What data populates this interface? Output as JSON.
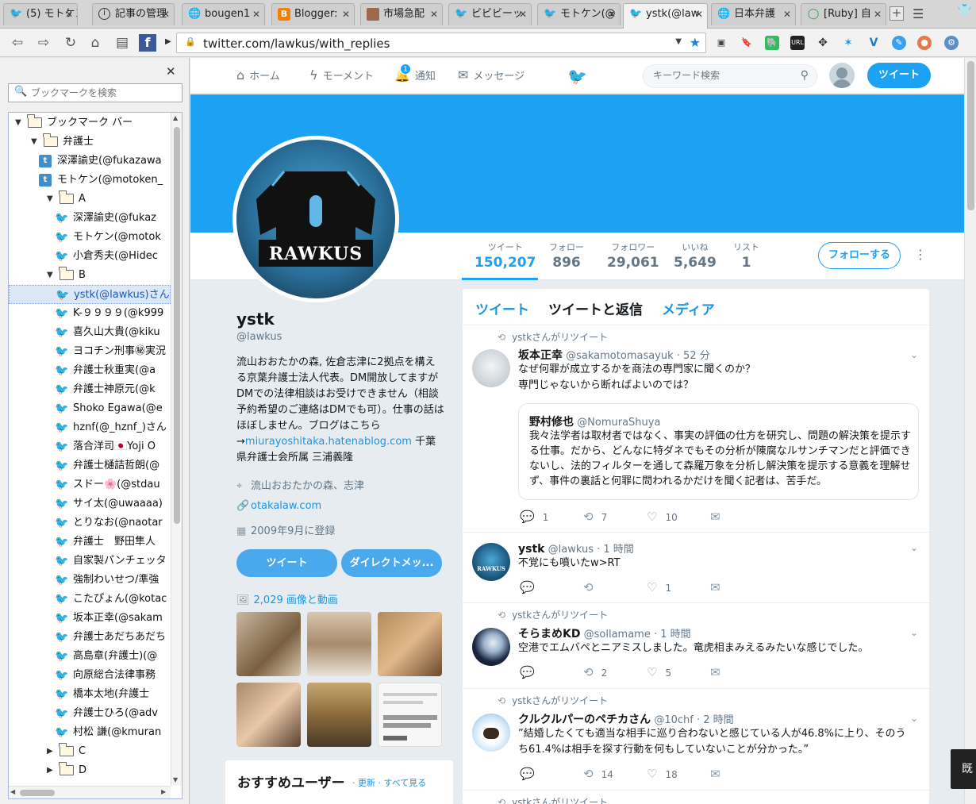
{
  "tabs": [
    {
      "label": "(5) モトケン",
      "icon": "twitter-icon"
    },
    {
      "label": "記事の管理",
      "icon": "info-icon"
    },
    {
      "label": "bougen1",
      "icon": "globe-icon"
    },
    {
      "label": "Blogger:",
      "icon": "blogger-icon"
    },
    {
      "label": "市場急配",
      "icon": "photo-icon"
    },
    {
      "label": "ビビビーッ",
      "icon": "twitter-icon"
    },
    {
      "label": "モトケン(@",
      "icon": "twitter-icon"
    },
    {
      "label": "ystk(@law",
      "icon": "twitter-icon"
    },
    {
      "label": "日本弁護",
      "icon": "globe-icon"
    },
    {
      "label": "[Ruby] 自",
      "icon": "green-icon"
    }
  ],
  "browser": {
    "url": "twitter.com/lawkus/with_replies",
    "ext_labels": [
      "URL"
    ]
  },
  "sidebar": {
    "search_placeholder": "ブックマークを検索",
    "items": [
      {
        "label": "ブックマーク バー",
        "type": "folder",
        "depth": 0,
        "expanded": true
      },
      {
        "label": "弁護士",
        "type": "folder",
        "depth": 1,
        "expanded": true
      },
      {
        "label": "深澤諭史(@fukazawa",
        "type": "bookmark-tb",
        "depth": 2
      },
      {
        "label": "モトケン(@motoken_",
        "type": "bookmark-tb",
        "depth": 2
      },
      {
        "label": "A",
        "type": "folder",
        "depth": 2,
        "expanded": true
      },
      {
        "label": "深澤諭史(@fukaz",
        "type": "bookmark",
        "depth": 3
      },
      {
        "label": "モトケン(@motok",
        "type": "bookmark",
        "depth": 3
      },
      {
        "label": "小倉秀夫(@Hidec",
        "type": "bookmark",
        "depth": 3
      },
      {
        "label": "B",
        "type": "folder",
        "depth": 2,
        "expanded": true
      },
      {
        "label": "ystk(@lawkus)さん",
        "type": "bookmark",
        "depth": 3,
        "selected": true
      },
      {
        "label": "K-９９９９(@k999",
        "type": "bookmark",
        "depth": 3
      },
      {
        "label": "喜久山大貴(@kiku",
        "type": "bookmark",
        "depth": 3
      },
      {
        "label": "ヨコチン刑事㊙実況",
        "type": "bookmark",
        "depth": 3
      },
      {
        "label": "弁護士秋重実(@a",
        "type": "bookmark",
        "depth": 3
      },
      {
        "label": "弁護士神原元(@k",
        "type": "bookmark",
        "depth": 3
      },
      {
        "label": "Shoko Egawa(@e",
        "type": "bookmark",
        "depth": 3
      },
      {
        "label": "hznf(@_hznf_)さん",
        "type": "bookmark",
        "depth": 3
      },
      {
        "label": "落合洋司🇯🇵Yoji O",
        "type": "bookmark",
        "depth": 3
      },
      {
        "label": "弁護士樋詰哲朗(@",
        "type": "bookmark",
        "depth": 3
      },
      {
        "label": "スドー🌸(@stdau",
        "type": "bookmark",
        "depth": 3
      },
      {
        "label": "サイ太(@uwaaaa)",
        "type": "bookmark",
        "depth": 3
      },
      {
        "label": "とりなお(@naotar",
        "type": "bookmark",
        "depth": 3
      },
      {
        "label": "弁護士　野田隼人",
        "type": "bookmark",
        "depth": 3
      },
      {
        "label": "自家製パンチェッタ",
        "type": "bookmark",
        "depth": 3
      },
      {
        "label": "強制わいせつ/準強",
        "type": "bookmark",
        "depth": 3
      },
      {
        "label": "こたぴょん(@kotac",
        "type": "bookmark",
        "depth": 3
      },
      {
        "label": "坂本正幸(@sakam",
        "type": "bookmark",
        "depth": 3
      },
      {
        "label": "弁護士あだちあだち",
        "type": "bookmark",
        "depth": 3
      },
      {
        "label": "高島章(弁護士)(@",
        "type": "bookmark",
        "depth": 3
      },
      {
        "label": "向原総合法律事務",
        "type": "bookmark",
        "depth": 3
      },
      {
        "label": "橋本太地(弁護士",
        "type": "bookmark",
        "depth": 3
      },
      {
        "label": "弁護士ひろ(@adv",
        "type": "bookmark",
        "depth": 3
      },
      {
        "label": "村松 謙(@kmuran",
        "type": "bookmark",
        "depth": 3
      },
      {
        "label": "C",
        "type": "folder",
        "depth": 2,
        "expanded": false
      },
      {
        "label": "D",
        "type": "folder",
        "depth": 2,
        "expanded": false
      }
    ]
  },
  "twitter": {
    "nav": {
      "home": "ホーム",
      "moments": "モーメント",
      "notifications": "通知",
      "notif_count": "1",
      "messages": "メッセージ"
    },
    "search_placeholder": "キーワード検索",
    "tweet_button": "ツイート",
    "stats": [
      {
        "label": "ツイート",
        "value": "150,207"
      },
      {
        "label": "フォロー",
        "value": "896"
      },
      {
        "label": "フォロワー",
        "value": "29,061"
      },
      {
        "label": "いいね",
        "value": "5,649"
      },
      {
        "label": "リスト",
        "value": "1"
      }
    ],
    "follow_button": "フォローする",
    "avatar_text": "RAWKUS",
    "profile": {
      "name": "ystk",
      "handle": "@lawkus",
      "bio": "流山おおたかの森, 佐倉志津に2拠点を構える京葉弁護士法人代表。DM開放してますがDMでの法律相談はお受けできません（相談予約希望のご連絡はDMでも可）。仕事の話はほぼしません。ブログはこちら→",
      "bio_link": "miurayoshitaka.hatenablog.com",
      "bio_tail": " 千葉県弁護士会所属 三浦義隆",
      "location": "流山おおたかの森、志津",
      "website": "otakalaw.com",
      "joined": "2009年9月に登録",
      "tweet_btn": "ツイート",
      "dm_btn": "ダイレクトメッ...",
      "media_link": "2,029 画像と動画"
    },
    "recommend": {
      "title": "おすすめユーザー",
      "links": "· 更新 · すべて見る"
    },
    "timeline_tabs": [
      "ツイート",
      "ツイートと返信",
      "メディア"
    ],
    "tweets": [
      {
        "retweeted_by": "ystkさんがリツイート",
        "name": "坂本正幸",
        "handle": "@sakamotomasayuk",
        "time": "· 52 分",
        "text": "なぜ何罪が成立するかを商法の専門家に聞くのか？\n専門じゃないから断ればよいのでは？",
        "quote_name": "野村修也",
        "quote_handle": "@NomuraShuya",
        "quote_text": "我々法学者は取材者ではなく、事実の評価の仕方を研究し、問題の解決策を提示する仕事。だから、どんなに特ダネでもその分析が陳腐なルサンチマンだと評価できないし、法的フィルターを通して森羅万象を分析し解決策を提示する意義を理解せず、事件の裏話と何罪に問われるかだけを聞く記者は、苦手だ。",
        "replies": "1",
        "retweets": "7",
        "likes": "10"
      },
      {
        "retweeted_by": "",
        "name": "ystk",
        "handle": "@lawkus",
        "time": "· 1 時間",
        "text": "不覚にも噴いたw>RT",
        "replies": "",
        "retweets": "",
        "likes": "1"
      },
      {
        "retweeted_by": "ystkさんがリツイート",
        "name": "そらまめKD",
        "handle": "@sollamame",
        "time": "· 1 時間",
        "text": "空港でエムバペとニアミスしました。竜虎相まみえるみたいな感じでした。",
        "replies": "",
        "retweets": "2",
        "likes": "5"
      },
      {
        "retweeted_by": "ystkさんがリツイート",
        "name": "クルクルパーのペチカさん",
        "handle": "@10chf",
        "time": "· 2 時間",
        "text": "”結婚したくても適当な相手に巡り合わないと感じている人が46.8%に上り、そのうち61.4%は相手を探す行動を何もしていないことが分かった。”",
        "replies": "",
        "retweets": "14",
        "likes": "18"
      }
    ],
    "next_retweet_label": "ystkさんがリツイート"
  },
  "toast": "既",
  "colors": {
    "twitter_blue": "#1da1f2",
    "link_blue": "#1b95e0",
    "banner": "#1da1f2"
  }
}
